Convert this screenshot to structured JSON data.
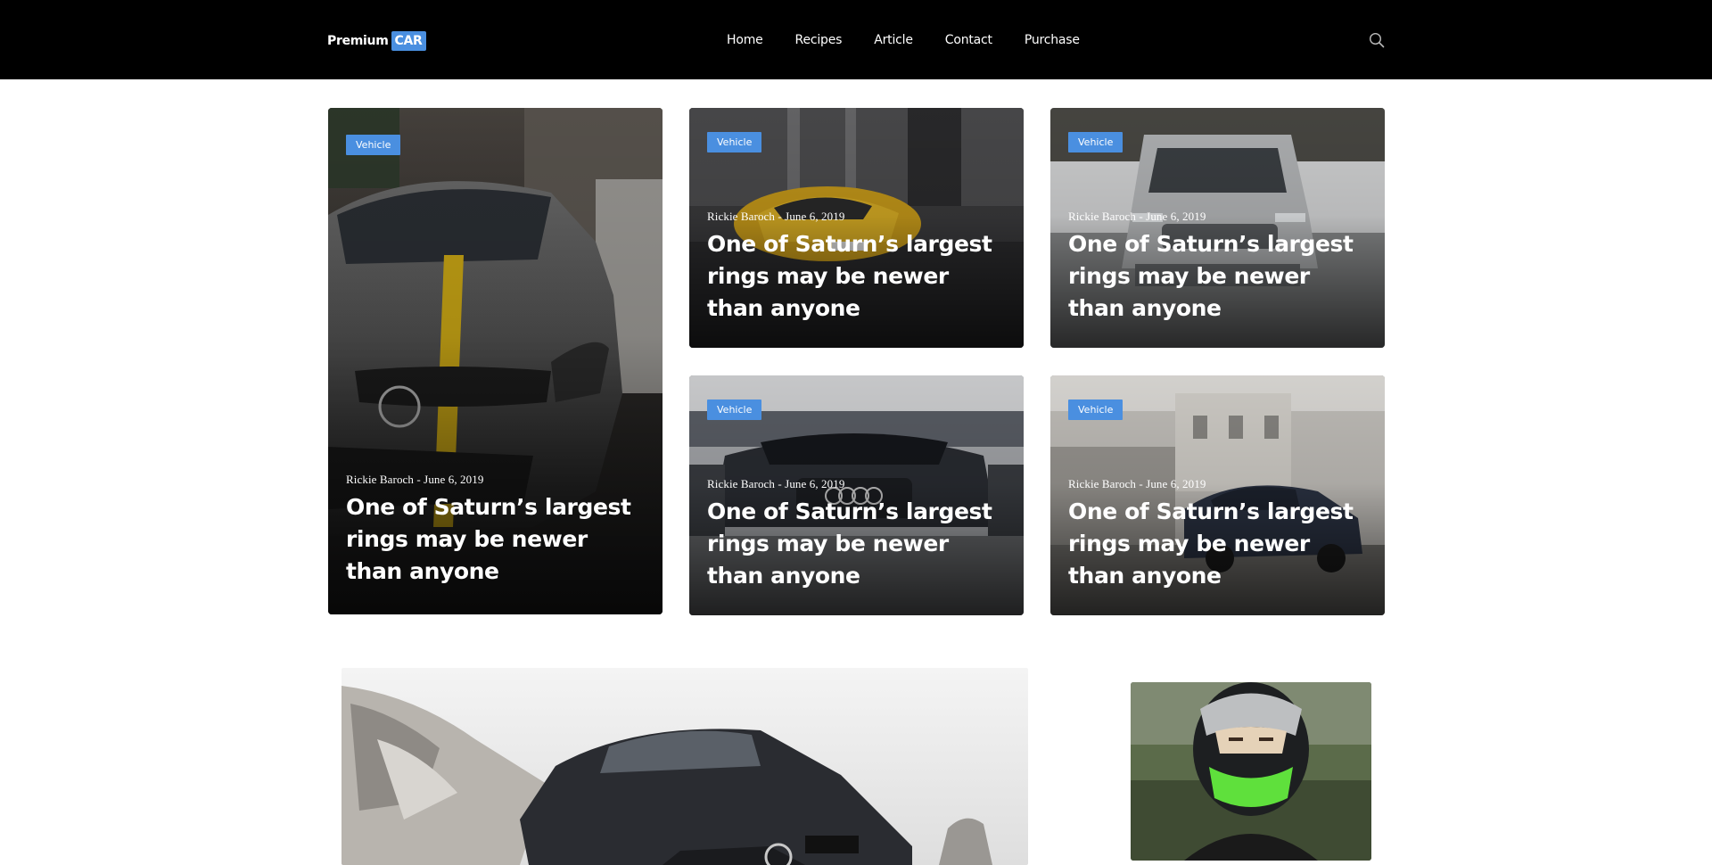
{
  "header": {
    "logo_text": "Premium",
    "logo_badge": "CAR",
    "nav": [
      "Home",
      "Recipes",
      "Article",
      "Contact",
      "Purchase"
    ]
  },
  "icons": {
    "search": "search-icon"
  },
  "colors": {
    "accent": "#4a8fe0",
    "header_bg": "#000000"
  },
  "cards": [
    {
      "badge": "Vehicle",
      "meta": "Rickie Baroch - June 6, 2019",
      "title": "One of Saturn’s largest rings may be newer than anyone",
      "image": "dark mercedes coupe with yellow stripe"
    },
    {
      "badge": "Vehicle",
      "meta": "Rickie Baroch - June 6, 2019",
      "title": "One of Saturn’s largest rings may be newer than anyone",
      "image": "yellow sports car on street"
    },
    {
      "badge": "Vehicle",
      "meta": "Rickie Baroch - June 6, 2019",
      "title": "One of Saturn’s largest rings may be newer than anyone",
      "image": "white suv in snow"
    },
    {
      "badge": "Vehicle",
      "meta": "Rickie Baroch - June 6, 2019",
      "title": "One of Saturn’s largest rings may be newer than anyone",
      "image": "dark audi sedan front"
    },
    {
      "badge": "Vehicle",
      "meta": "Rickie Baroch - June 6, 2019",
      "title": "One of Saturn’s largest rings may be newer than anyone",
      "image": "classic blue car near building"
    }
  ]
}
